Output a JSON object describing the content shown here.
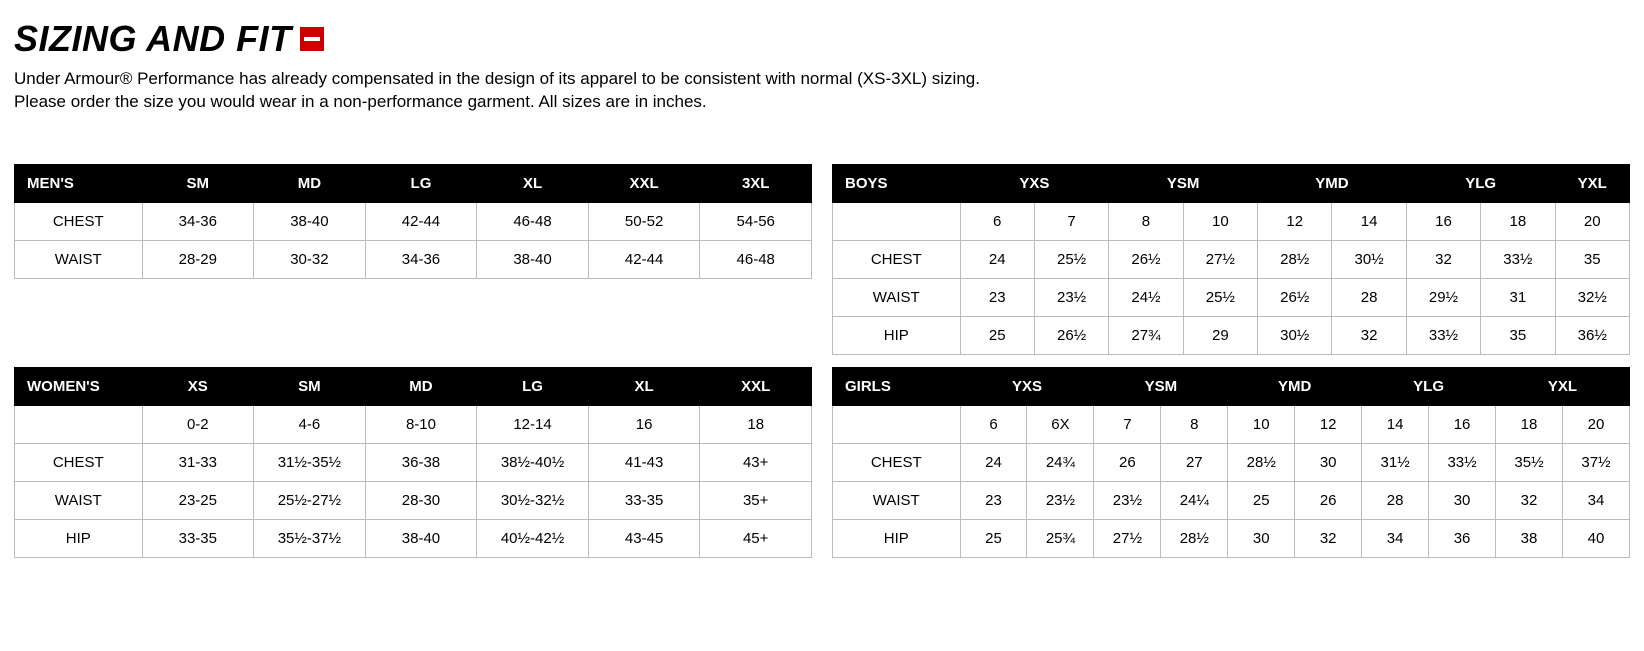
{
  "page": {
    "title": "SIZING AND FIT",
    "desc1": "Under Armour® Performance has already compensated in the design of its apparel to be consistent with normal (XS-3XL) sizing.",
    "desc2": "Please order the size you would wear in a non-performance garment. All sizes are in inches."
  },
  "tables": {
    "mens": {
      "name": "MEN'S",
      "sizes": [
        "SM",
        "MD",
        "LG",
        "XL",
        "XXL",
        "3XL"
      ],
      "rows": [
        {
          "label": "CHEST",
          "v": [
            "34-36",
            "38-40",
            "42-44",
            "46-48",
            "50-52",
            "54-56"
          ]
        },
        {
          "label": "WAIST",
          "v": [
            "28-29",
            "30-32",
            "34-36",
            "38-40",
            "42-44",
            "46-48"
          ]
        }
      ]
    },
    "womens": {
      "name": "WOMEN'S",
      "sizes": [
        "XS",
        "SM",
        "MD",
        "LG",
        "XL",
        "XXL"
      ],
      "rows": [
        {
          "label": "",
          "v": [
            "0-2",
            "4-6",
            "8-10",
            "12-14",
            "16",
            "18"
          ]
        },
        {
          "label": "CHEST",
          "v": [
            "31-33",
            "31½-35½",
            "36-38",
            "38½-40½",
            "41-43",
            "43+"
          ]
        },
        {
          "label": "WAIST",
          "v": [
            "23-25",
            "25½-27½",
            "28-30",
            "30½-32½",
            "33-35",
            "35+"
          ]
        },
        {
          "label": "HIP",
          "v": [
            "33-35",
            "35½-37½",
            "38-40",
            "40½-42½",
            "43-45",
            "45+"
          ]
        }
      ]
    },
    "boys": {
      "name": "BOYS",
      "sizes": [
        "YXS",
        "YSM",
        "YMD",
        "YLG",
        "YXL"
      ],
      "rows": [
        {
          "label": "",
          "v": [
            "6",
            "7",
            "8",
            "10",
            "12",
            "14",
            "16",
            "18",
            "20"
          ]
        },
        {
          "label": "CHEST",
          "v": [
            "24",
            "25½",
            "26½",
            "27½",
            "28½",
            "30½",
            "32",
            "33½",
            "35"
          ]
        },
        {
          "label": "WAIST",
          "v": [
            "23",
            "23½",
            "24½",
            "25½",
            "26½",
            "28",
            "29½",
            "31",
            "32½"
          ]
        },
        {
          "label": "HIP",
          "v": [
            "25",
            "26½",
            "27¾",
            "29",
            "30½",
            "32",
            "33½",
            "35",
            "36½"
          ]
        }
      ]
    },
    "girls": {
      "name": "GIRLS",
      "sizes": [
        "YXS",
        "YSM",
        "YMD",
        "YLG",
        "YXL"
      ],
      "rows": [
        {
          "label": "",
          "v": [
            "6",
            "6X",
            "7",
            "8",
            "10",
            "12",
            "14",
            "16",
            "18",
            "20"
          ]
        },
        {
          "label": "CHEST",
          "v": [
            "24",
            "24¾",
            "26",
            "27",
            "28½",
            "30",
            "31½",
            "33½",
            "35½",
            "37½"
          ]
        },
        {
          "label": "WAIST",
          "v": [
            "23",
            "23½",
            "23½",
            "24¼",
            "25",
            "26",
            "28",
            "30",
            "32",
            "34"
          ]
        },
        {
          "label": "HIP",
          "v": [
            "25",
            "25¾",
            "27½",
            "28½",
            "30",
            "32",
            "34",
            "36",
            "38",
            "40"
          ]
        }
      ]
    }
  }
}
